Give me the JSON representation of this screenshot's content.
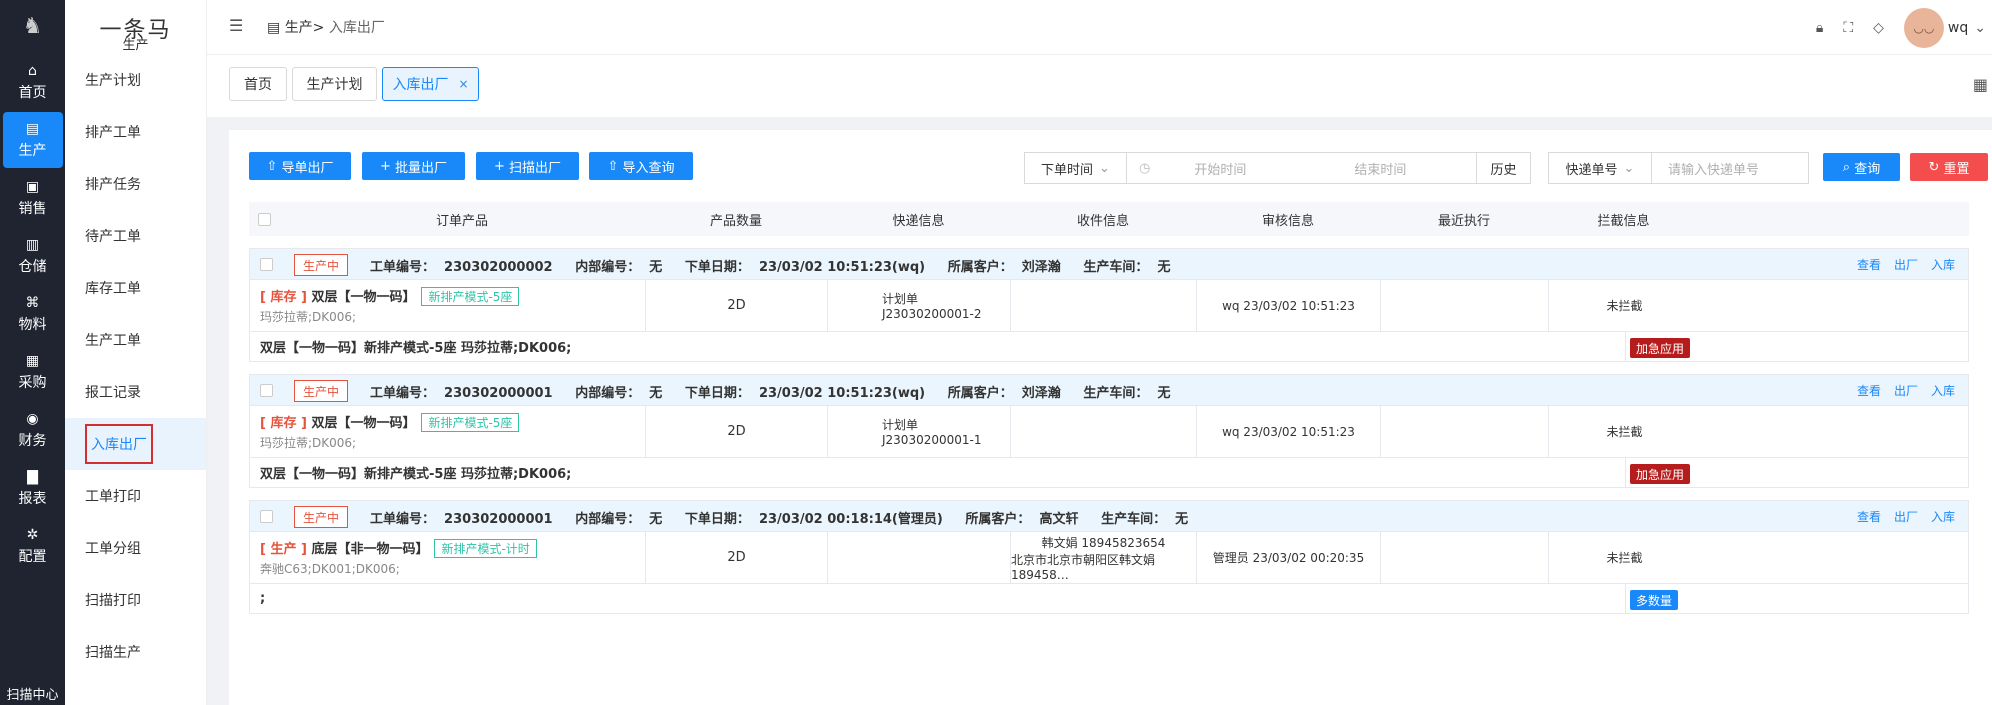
{
  "rail": {
    "items": [
      {
        "label": "首页",
        "icon": "home-icon",
        "glyph": "⌂"
      },
      {
        "label": "生产",
        "icon": "box-icon",
        "glyph": "▤"
      },
      {
        "label": "销售",
        "icon": "sales-icon",
        "glyph": "▣"
      },
      {
        "label": "仓储",
        "icon": "warehouse-icon",
        "glyph": "▥"
      },
      {
        "label": "物料",
        "icon": "material-icon",
        "glyph": "⌘"
      },
      {
        "label": "采购",
        "icon": "purchase-icon",
        "glyph": "▦"
      },
      {
        "label": "财务",
        "icon": "finance-icon",
        "glyph": "◉"
      },
      {
        "label": "报表",
        "icon": "report-icon",
        "glyph": "▇"
      },
      {
        "label": "配置",
        "icon": "settings-icon",
        "glyph": "✲"
      }
    ],
    "bottom": "扫描中心"
  },
  "side": {
    "brand": "一条马",
    "group": "生产",
    "items": [
      "生产计划",
      "排产工单",
      "排产任务",
      "待产工单",
      "库存工单",
      "生产工单",
      "报工记录",
      "入库出厂",
      "工单打印",
      "工单分组",
      "扫描打印",
      "扫描生产"
    ]
  },
  "header": {
    "crumb_root": "生产>",
    "crumb_last": "入库出厂",
    "user": "wq"
  },
  "tabs": [
    {
      "label": "首页"
    },
    {
      "label": "生产计划"
    },
    {
      "label": "入库出厂",
      "close": "×"
    }
  ],
  "toolbar": {
    "btn1": "导单出厂",
    "btn2": "批量出厂",
    "btn3": "扫描出厂",
    "btn4": "导入查询",
    "time_type": "下单时间",
    "start_ph": "开始时间",
    "end_ph": "结束时间",
    "history": "历史",
    "express_type": "快递单号",
    "express_ph": "请输入快递单号",
    "search": "查询",
    "reset": "重置"
  },
  "columns": [
    "订单产品",
    "产品数量",
    "快递信息",
    "收件信息",
    "审核信息",
    "最近执行",
    "拦截信息"
  ],
  "orders": [
    {
      "status": "生产中",
      "meta": "工单编号：  230302000002     内部编号：  无     下单日期：  23/03/02 10:51:23(wq)     所属客户：  刘泽瀚     生产车间：  无",
      "ops": [
        "查看",
        "出厂",
        "入库"
      ],
      "prod_kind": "[ 库存 ]",
      "prod_name": " 双层【一物一码】",
      "mode": "新排产模式-5座",
      "prod_sub": "玛莎拉蒂;DK006;",
      "qty": "2D",
      "express_l1": "计划单",
      "express_l2": "J23030200001-2",
      "recv_l1": "",
      "recv_l2": "",
      "audit": "wq 23/03/02 10:51:23",
      "recent": "",
      "intercept": "未拦截",
      "foot": "双层【一物一码】新排产模式-5座 玛莎拉蒂;DK006;",
      "tag": "加急应用",
      "tag_color": "#b71c1c"
    },
    {
      "status": "生产中",
      "meta": "工单编号：  230302000001     内部编号：  无     下单日期：  23/03/02 10:51:23(wq)     所属客户：  刘泽瀚     生产车间：  无",
      "ops": [
        "查看",
        "出厂",
        "入库"
      ],
      "prod_kind": "[ 库存 ]",
      "prod_name": " 双层【一物一码】",
      "mode": "新排产模式-5座",
      "prod_sub": "玛莎拉蒂;DK006;",
      "qty": "2D",
      "express_l1": "计划单",
      "express_l2": "J23030200001-1",
      "recv_l1": "",
      "recv_l2": "",
      "audit": "wq 23/03/02 10:51:23",
      "recent": "",
      "intercept": "未拦截",
      "foot": "双层【一物一码】新排产模式-5座 玛莎拉蒂;DK006;",
      "tag": "加急应用",
      "tag_color": "#b71c1c"
    },
    {
      "status": "生产中",
      "meta": "工单编号：  230302000001     内部编号：  无     下单日期：  23/03/02 00:18:14(管理员)     所属客户：  高文轩     生产车间：  无",
      "ops": [
        "查看",
        "出厂",
        "入库"
      ],
      "prod_kind": "[ 生产 ]",
      "prod_name": " 底层【非一物一码】",
      "mode": "新排产模式-计时",
      "prod_sub": "奔驰C63;DK001;DK006;",
      "qty": "2D",
      "express_l1": "",
      "express_l2": "",
      "recv_l1": "韩文娟 18945823654",
      "recv_l2": "北京市北京市朝阳区韩文娟189458…",
      "audit": "管理员 23/03/02 00:20:35",
      "recent": "",
      "intercept": "未拦截",
      "foot": ";",
      "tag": "多数量",
      "tag_color": "#1989fa"
    }
  ]
}
